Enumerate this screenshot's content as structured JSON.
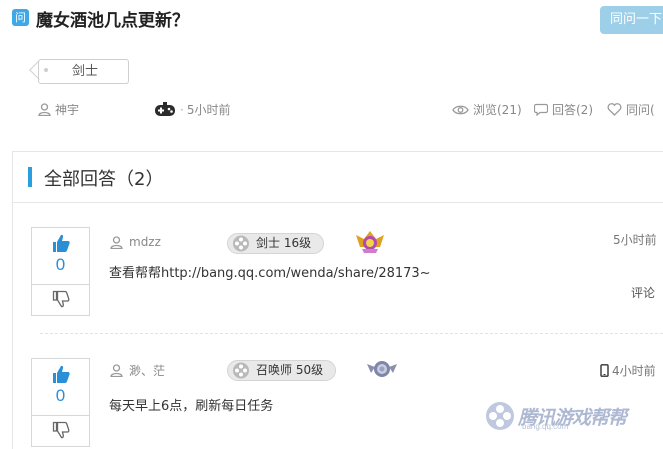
{
  "question": {
    "icon_text": "问",
    "title": "魔女酒池几点更新？",
    "ask_button": "同问一下",
    "tag": "剑士",
    "author": "神宇",
    "time": "5小时前",
    "views": "浏览(21)",
    "answers": "回答(2)",
    "same_ask": "同问("
  },
  "section": {
    "title": "全部回答（2）"
  },
  "answers": [
    {
      "username": "mdzz",
      "level": "剑士 16级",
      "time": "5小时前",
      "content": "查看帮帮http://bang.qq.com/wenda/share/28173~",
      "comment": "评论",
      "likes": "0"
    },
    {
      "username": "渺、茫",
      "level": "召唤师 50级",
      "time": "4小时前",
      "content": "每天早上6点，刷新每日任务",
      "likes": "0"
    }
  ],
  "watermark": {
    "text": "腾讯游戏帮帮",
    "url": "bang.qq.com"
  },
  "colors": {
    "accent": "#2a9fe0",
    "ask_button": "#9ecfe8",
    "like_blue": "#2a8fd6"
  }
}
